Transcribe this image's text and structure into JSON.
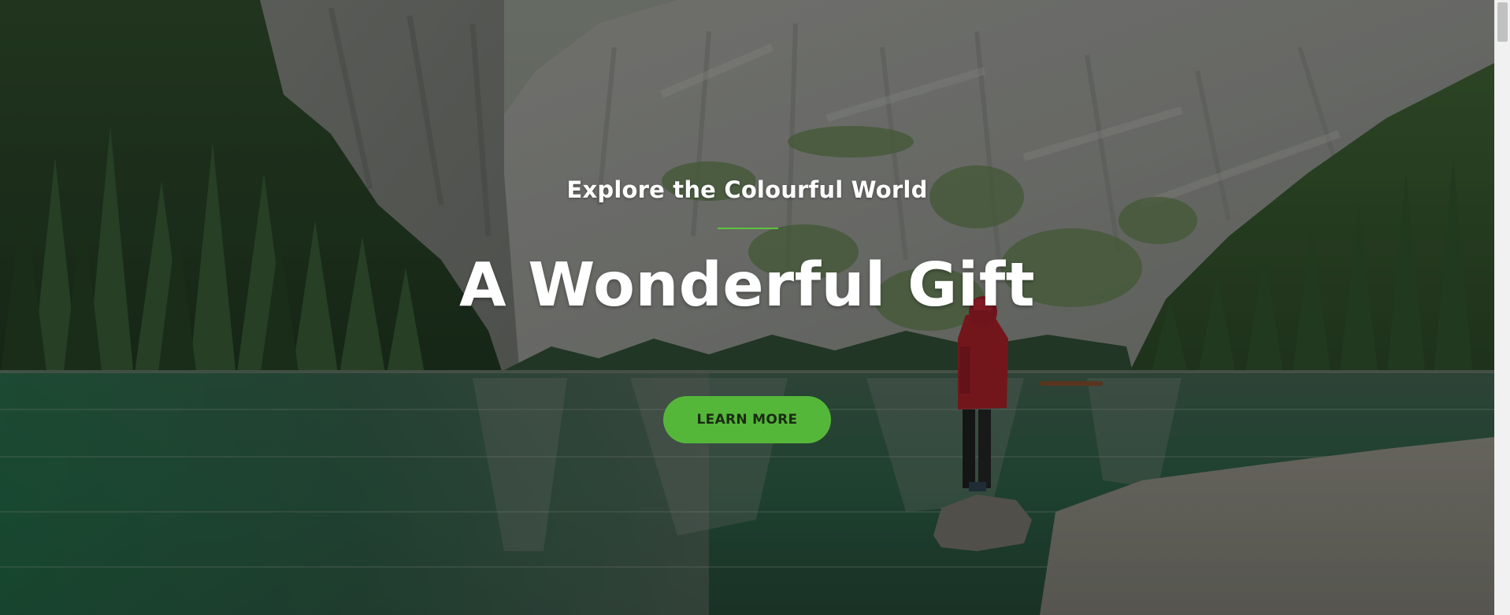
{
  "hero": {
    "subtitle": "Explore the Colourful World",
    "title": "A Wonderful Gift",
    "cta_label": "LEARN MORE",
    "background_description_icon": "mountain-lake-photo"
  },
  "colors": {
    "accent": "#55b73a",
    "divider": "#5dc23a",
    "text": "#ffffff"
  }
}
